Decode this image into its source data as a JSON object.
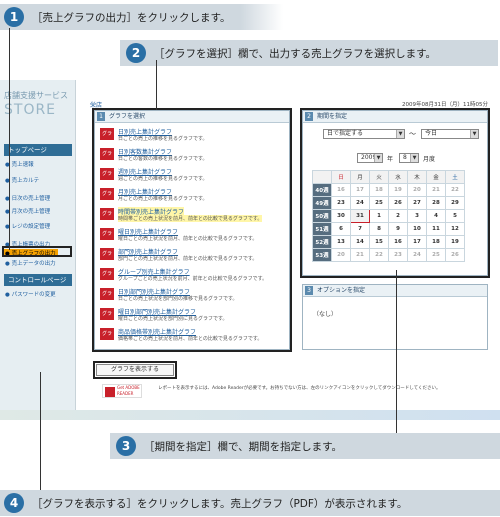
{
  "callouts": {
    "c1": {
      "num": "1",
      "text": "［売上グラフの出力］をクリックします。"
    },
    "c2": {
      "num": "2",
      "text": "［グラフを選択］欄で、出力する売上グラフを選択します。"
    },
    "c3": {
      "num": "3",
      "text": "［期間を指定］欄で、期間を指定します。"
    },
    "c4": {
      "num": "4",
      "text": "［グラフを表示する］をクリックします。売上グラフ（PDF）が表示されます。"
    }
  },
  "brand": {
    "jp": "店舗支援サービス",
    "en": "STORE"
  },
  "sidebar": {
    "top_head": "トップページ",
    "items_a": [
      "売上速報",
      "売上カルテ",
      "日次の売上管理",
      "月次の売上管理",
      "レジの設定管理"
    ],
    "items_b": [
      "売上帳票の出力",
      "売上グラフの出力",
      "売上データの出力"
    ],
    "control_head": "コントロールページ",
    "items_c": [
      "パスワードの変更"
    ]
  },
  "header": {
    "crumb": "栄店",
    "date": "2009年08月31日（月）11時05分"
  },
  "panel1": {
    "num": "1",
    "title": "グラフを選択",
    "icon_label": "グラフ",
    "graphs": [
      {
        "name": "日別売上集計グラフ",
        "desc": "日ごとの売上の推移を見るグラフです。"
      },
      {
        "name": "日別客数集計グラフ",
        "desc": "日ごとの客数の推移を見るグラフです。"
      },
      {
        "name": "週別売上集計グラフ",
        "desc": "週ごとの売上の推移を見るグラフです。"
      },
      {
        "name": "月別売上集計グラフ",
        "desc": "月ごとの売上の推移を見るグラフです。"
      },
      {
        "name": "時間帯別売上集計グラフ",
        "desc": "時間帯ごとの売上状況を前月、前年との比較で見るグラフです。"
      },
      {
        "name": "曜日別売上集計グラフ",
        "desc": "曜日ごとの売上状況を前月、前年との比較で見るグラフです。"
      },
      {
        "name": "部門別売上集計グラフ",
        "desc": "部門ごとの売上状況を前月、前年との比較で見るグラフです。"
      },
      {
        "name": "グループ別売上集計グラフ",
        "desc": "グループごとの売上状況を前月、前年との比較で見るグラフです。"
      },
      {
        "name": "日別部門別売上集計グラフ",
        "desc": "日ごとの売上状況を部門別の推移で見るグラフです。"
      },
      {
        "name": "曜日別部門別売上集計グラフ",
        "desc": "曜日ごとの売上状況を部門別に見るグラフです。"
      },
      {
        "name": "商品価格帯別売上集計グラフ",
        "desc": "価格帯ごとの売上状況を前月、前年との比較で見るグラフです。"
      }
    ]
  },
  "panel2": {
    "num": "2",
    "title": "期間を指定",
    "mode_select": "日で指定する",
    "tilde": "～",
    "end_select": "今日",
    "year": "2009",
    "year_unit": "年",
    "month": "8",
    "month_unit": "月度",
    "weekdays": [
      "日",
      "月",
      "火",
      "水",
      "木",
      "金",
      "土"
    ],
    "weeks": [
      {
        "wk": "40週",
        "days": [
          "16",
          "17",
          "18",
          "19",
          "20",
          "21",
          "22"
        ]
      },
      {
        "wk": "49週",
        "days": [
          "23",
          "24",
          "25",
          "26",
          "27",
          "28",
          "29"
        ]
      },
      {
        "wk": "50週",
        "days": [
          "30",
          "31",
          "1",
          "2",
          "3",
          "4",
          "5"
        ]
      },
      {
        "wk": "51週",
        "days": [
          "6",
          "7",
          "8",
          "9",
          "10",
          "11",
          "12"
        ]
      },
      {
        "wk": "52週",
        "days": [
          "13",
          "14",
          "15",
          "16",
          "17",
          "18",
          "19"
        ]
      },
      {
        "wk": "53週",
        "days": [
          "20",
          "21",
          "22",
          "23",
          "24",
          "25",
          "26"
        ]
      }
    ]
  },
  "panel3": {
    "num": "3",
    "title": "オプションを指定",
    "value": "（なし）"
  },
  "actions": {
    "show_button": "グラフを表示する",
    "reader_logo": "Get ADOBE READER",
    "reader_text": "レポートを表示するには、Adobe Readerが必要です。お持ちでない方は、左のリンクアイコンをクリックしてダウンロードしてください。"
  }
}
